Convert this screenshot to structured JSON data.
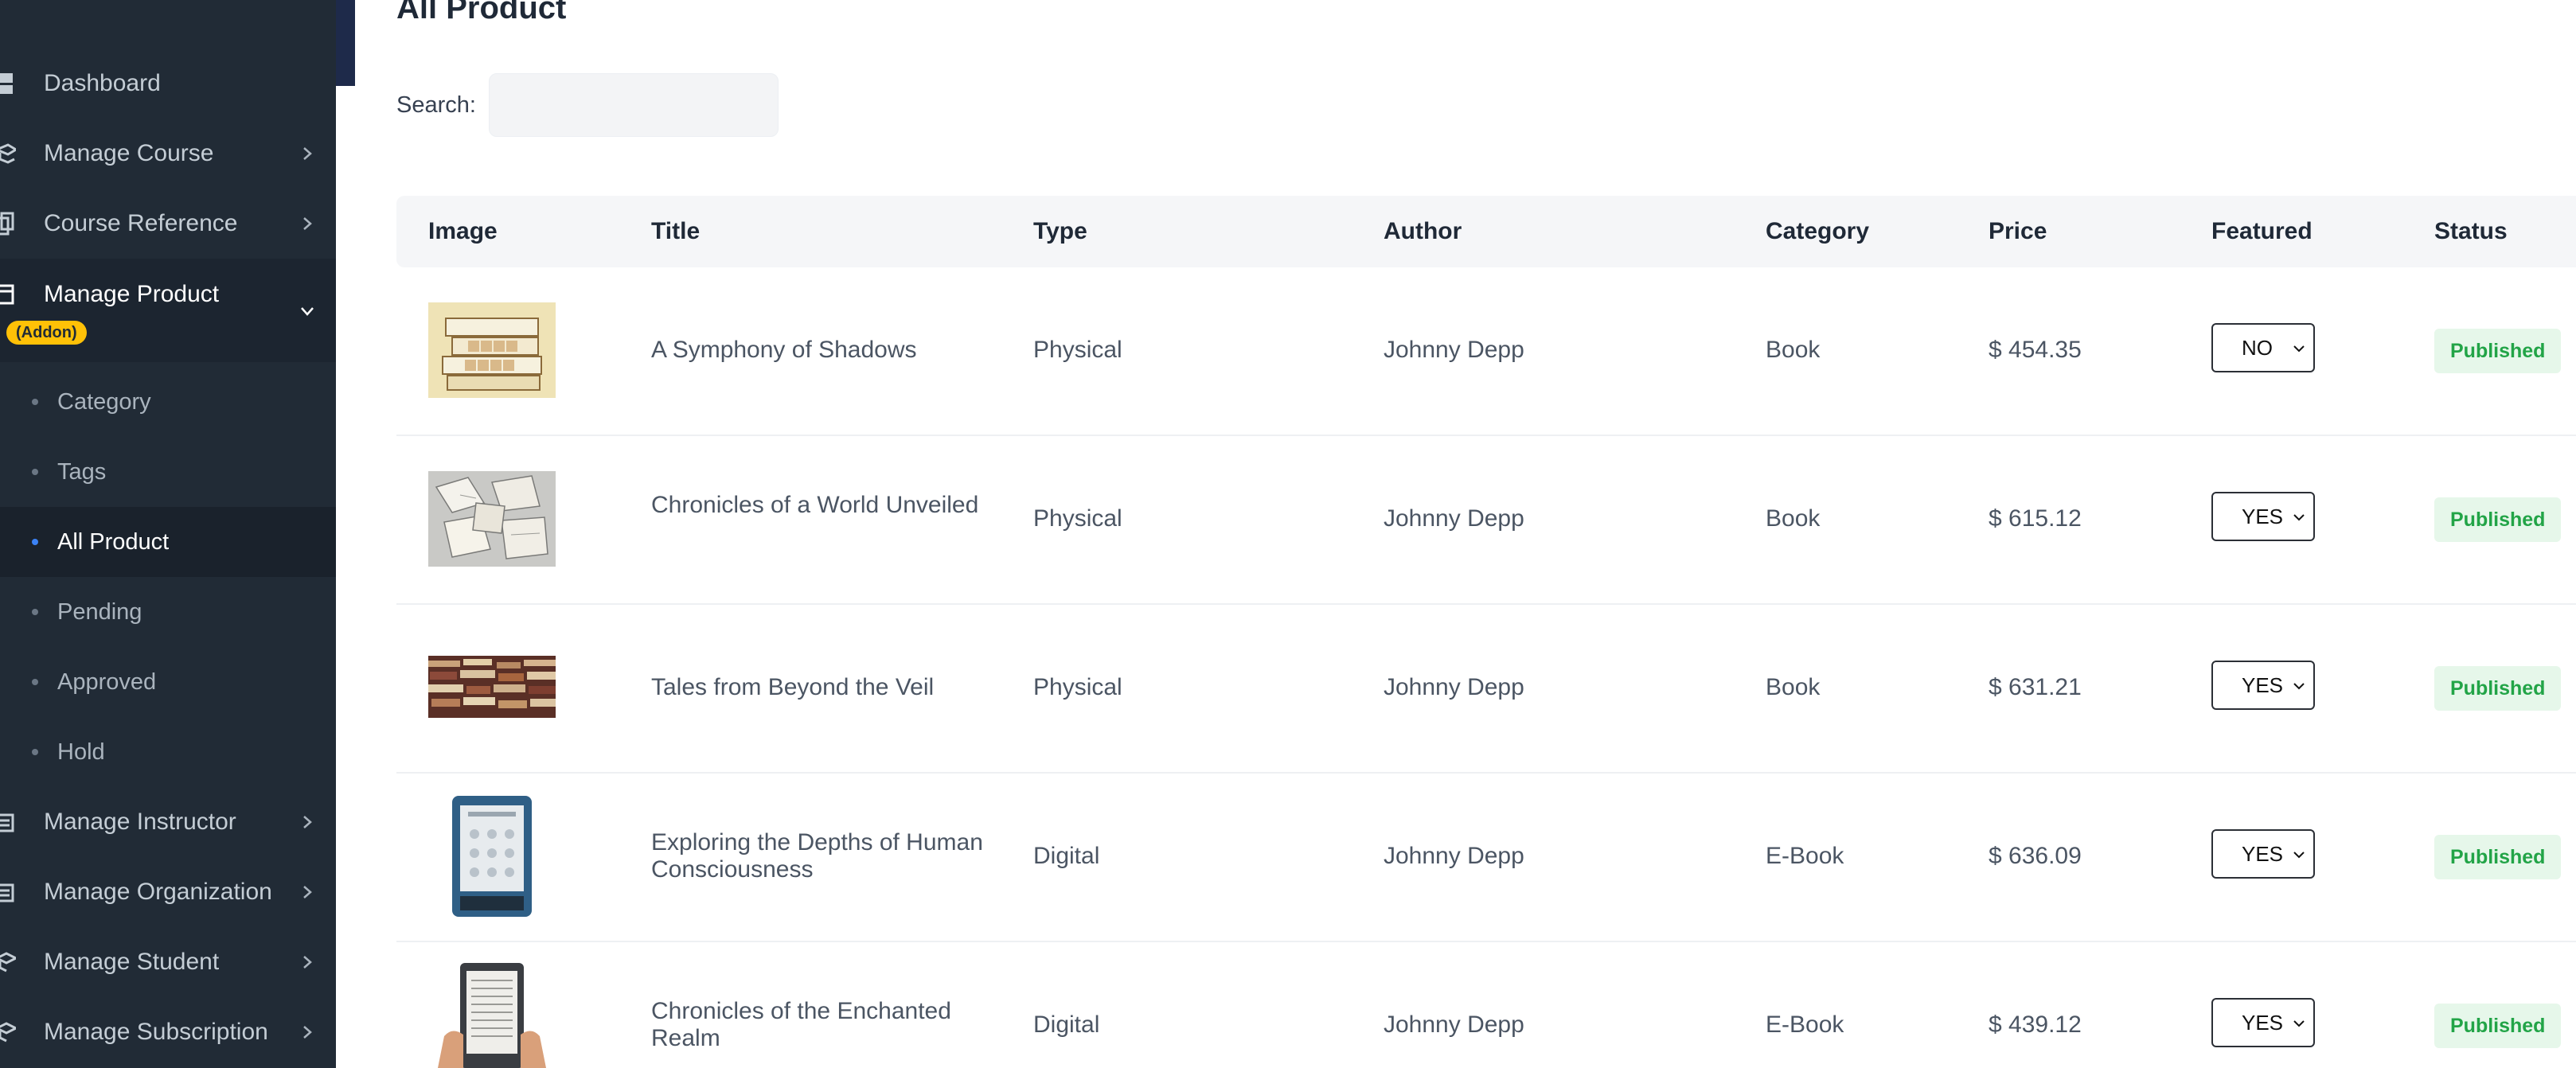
{
  "sidebar": {
    "items": [
      {
        "label": "Dashboard",
        "icon": "dashboard-icon",
        "chevron": false
      },
      {
        "label": "Manage Course",
        "icon": "course-icon",
        "chevron": true
      },
      {
        "label": "Course Reference",
        "icon": "reference-icon",
        "chevron": true
      },
      {
        "label": "Manage Product",
        "icon": "product-icon",
        "chevron": true
      },
      {
        "label": "Manage Instructor",
        "icon": "instructor-icon",
        "chevron": true
      },
      {
        "label": "Manage Organization",
        "icon": "organization-icon",
        "chevron": true
      },
      {
        "label": "Manage Student",
        "icon": "student-icon",
        "chevron": true
      },
      {
        "label": "Manage Subscription",
        "icon": "subscription-icon",
        "chevron": true
      }
    ],
    "addon_badge": "(Addon)",
    "sub_items": [
      {
        "label": "Category"
      },
      {
        "label": "Tags"
      },
      {
        "label": "All Product"
      },
      {
        "label": "Pending"
      },
      {
        "label": "Approved"
      },
      {
        "label": "Hold"
      }
    ]
  },
  "page": {
    "title": "All Product",
    "search_label": "Search:",
    "search_value": "",
    "search_placeholder": ""
  },
  "table": {
    "headers": [
      "Image",
      "Title",
      "Type",
      "Author",
      "Category",
      "Price",
      "Featured",
      "Status"
    ],
    "rows": [
      {
        "image": "scrabble-books-image",
        "title": "A Symphony of Shadows",
        "type": "Physical",
        "author": "Johnny Depp",
        "category": "Book",
        "price": "$ 454.35",
        "featured": "NO",
        "status": "Published"
      },
      {
        "image": "open-books-image",
        "title": "Chronicles of a World Unveiled",
        "type": "Physical",
        "author": "Johnny Depp",
        "category": "Book",
        "price": "$ 615.12",
        "featured": "YES",
        "status": "Published"
      },
      {
        "image": "book-stacks-image",
        "title": "Tales from Beyond the Veil",
        "type": "Physical",
        "author": "Johnny Depp",
        "category": "Book",
        "price": "$ 631.21",
        "featured": "YES",
        "status": "Published"
      },
      {
        "image": "ereader-image",
        "title": "Exploring the Depths of Human Consciousness",
        "type": "Digital",
        "author": "Johnny Depp",
        "category": "E-Book",
        "price": "$ 636.09",
        "featured": "YES",
        "status": "Published"
      },
      {
        "image": "ereader-hands-image",
        "title": "Chronicles of the Enchanted Realm",
        "type": "Digital",
        "author": "Johnny Depp",
        "category": "E-Book",
        "price": "$ 439.12",
        "featured": "YES",
        "status": "Published"
      }
    ]
  },
  "colors": {
    "sidebar_bg": "#212b36",
    "addon_badge": "#ffc107",
    "status_bg": "#e6f7ea",
    "status_text": "#22a447",
    "active_dot": "#3b82f6"
  }
}
